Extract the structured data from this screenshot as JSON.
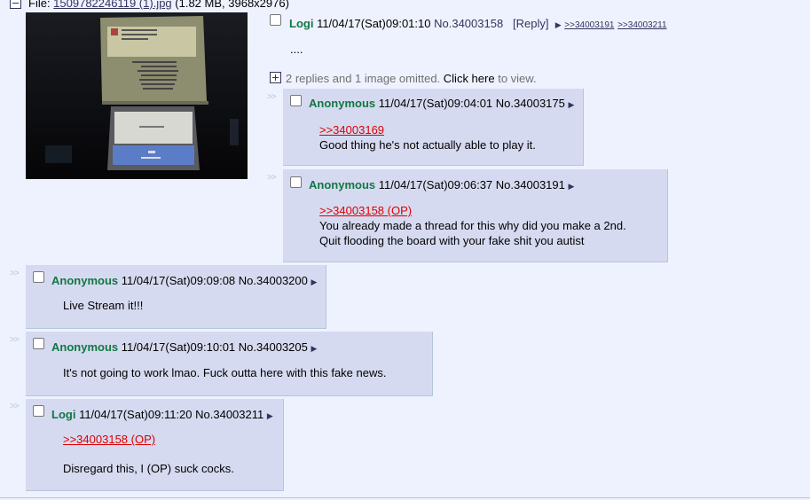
{
  "op": {
    "file_prefix": "File: ",
    "file_link": "1509782246119 (1).jpg",
    "file_info": " (1.82 MB, 3968x2976)",
    "name": "Logi",
    "datetime": "11/04/17(Sat)09:01:10",
    "post_no": "No.34003158",
    "reply_link": "[Reply]",
    "backlinks": [
      ">>34003191",
      ">>34003211"
    ],
    "message": "....",
    "omitted_text": "2 replies and 1 image omitted.",
    "click_here": "Click here",
    "to_view": "to view."
  },
  "replies": [
    {
      "name": "Anonymous",
      "datetime": "11/04/17(Sat)09:04:01",
      "post_no": "No.34003175",
      "quote": ">>34003169",
      "lines": [
        "Good thing he's not actually able to play it."
      ]
    },
    {
      "name": "Anonymous",
      "datetime": "11/04/17(Sat)09:06:37",
      "post_no": "No.34003191",
      "quote": ">>34003158 (OP)",
      "lines": [
        "You already made a thread for this why did you make a 2nd.",
        "Quit flooding the board with your fake shit you autist"
      ]
    },
    {
      "name": "Anonymous",
      "datetime": "11/04/17(Sat)09:09:08",
      "post_no": "No.34003200",
      "lines": [
        "Live Stream it!!!"
      ]
    },
    {
      "name": "Anonymous",
      "datetime": "11/04/17(Sat)09:10:01",
      "post_no": "No.34003205",
      "lines": [
        "It's not going to work lmao. Fuck outta here with this fake news."
      ]
    },
    {
      "name": "Logi",
      "datetime": "11/04/17(Sat)09:11:20",
      "post_no": "No.34003211",
      "quote": ">>34003158 (OP)",
      "lines": [
        "Disregard this, I (OP) suck cocks."
      ]
    }
  ],
  "side_arrows": ">>",
  "arrow_glyph": "▶"
}
